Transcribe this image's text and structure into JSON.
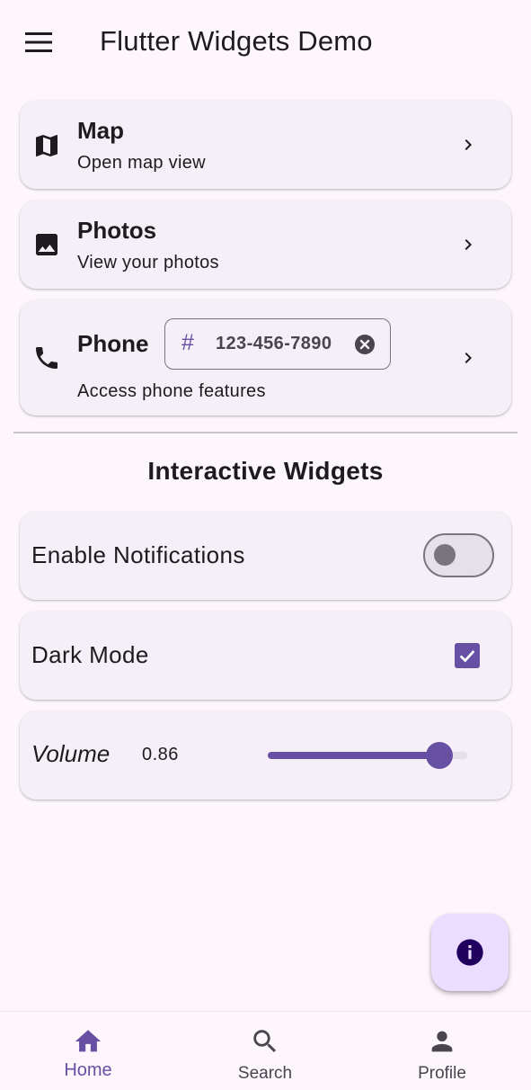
{
  "app_bar": {
    "title": "Flutter Widgets Demo",
    "menu_icon": "menu-icon"
  },
  "tiles": [
    {
      "title": "Map",
      "subtitle": "Open map view",
      "icon": "map-icon"
    },
    {
      "title": "Photos",
      "subtitle": "View your photos",
      "icon": "image-icon"
    },
    {
      "title": "Phone",
      "subtitle": "Access phone features",
      "icon": "phone-icon",
      "chip": {
        "icon": "#",
        "label": "123-456-7890"
      }
    }
  ],
  "section_title": "Interactive Widgets",
  "notifications": {
    "label": "Enable Notifications",
    "enabled": false
  },
  "dark_mode": {
    "label": "Dark Mode",
    "checked": true
  },
  "volume": {
    "label": "Volume",
    "value_text": "0.86",
    "value": 0.86
  },
  "fab": {
    "icon": "info-icon"
  },
  "bottom_nav": {
    "items": [
      {
        "label": "Home",
        "icon": "home-icon",
        "selected": true
      },
      {
        "label": "Search",
        "icon": "search-icon",
        "selected": false
      },
      {
        "label": "Profile",
        "icon": "person-icon",
        "selected": false
      }
    ]
  },
  "colors": {
    "primary": "#6750a4",
    "background": "#fdf7fd",
    "card": "#f5eff7",
    "fab": "#eaddff",
    "on_surface": "#1d1b20",
    "muted": "#79747e"
  }
}
